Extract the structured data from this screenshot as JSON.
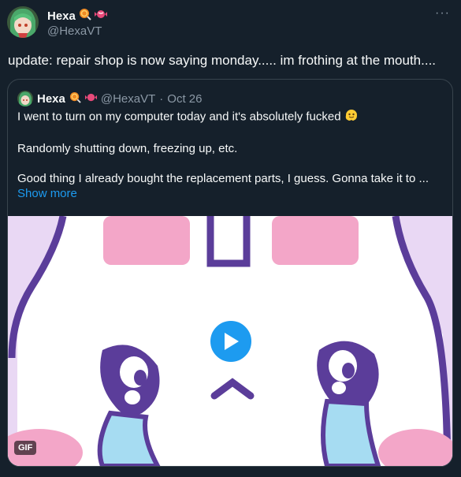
{
  "tweet": {
    "author_name": "Hexa",
    "author_handle": "@HexaVT",
    "body": "update: repair shop is now saying monday..... im frothing at the mouth....",
    "more_label": "···"
  },
  "quoted": {
    "author_name": "Hexa",
    "author_handle": "@HexaVT",
    "separator": "·",
    "date": "Oct 26",
    "line1": "I went to turn on my computer today and it's absolutely fucked",
    "line2": "Randomly shutting down, freezing up, etc.",
    "line3": "Good thing I already bought the replacement parts, I guess. Gonna take it to ...",
    "show_more": "Show more",
    "media_badge": "GIF"
  },
  "icons": [
    "lollipop-icon",
    "candy-icon",
    "melting-face-emoji",
    "play-icon",
    "more-icon"
  ],
  "colors": {
    "background": "#15202b",
    "text": "#f7f9f9",
    "secondary_text": "#8b98a5",
    "accent": "#1d9bf0",
    "border": "#38444d"
  }
}
